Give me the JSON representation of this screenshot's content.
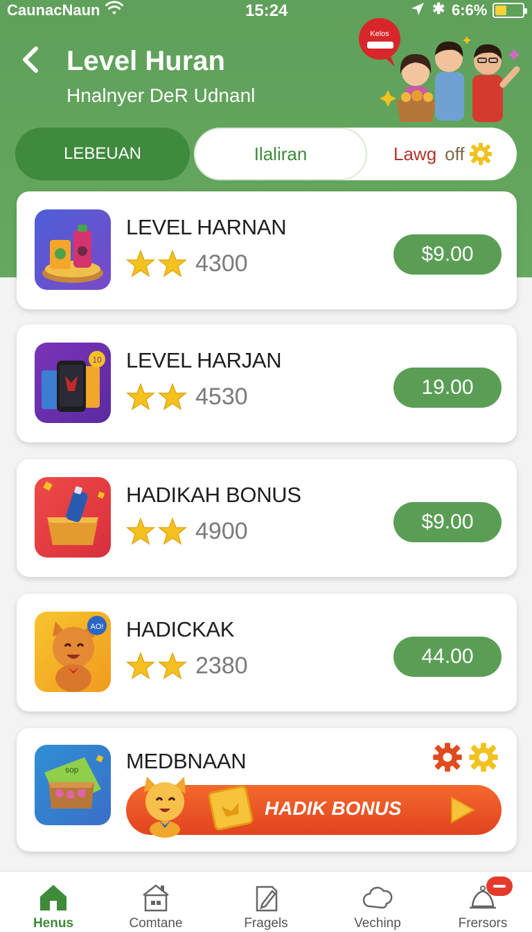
{
  "status_bar": {
    "carrier": "CaunacNaun",
    "time": "15:24",
    "battery": "6:6%",
    "bluetooth_glyph": "✱"
  },
  "header": {
    "back_icon": "chevron-left-icon",
    "title": "Level Huran",
    "subtitle": "Hnalnyer DeR Udnanl",
    "bubble_text": "Kelos"
  },
  "tabs": [
    {
      "label": "LEBEUAN",
      "active": true
    },
    {
      "label": "Ilaliran",
      "active": false
    },
    {
      "label": "Lawg",
      "label_suffix": "off",
      "active": false,
      "icon": "gear-icon"
    }
  ],
  "items": [
    {
      "name": "LEVEL HARNAN",
      "score": "4300",
      "price": "$9.00",
      "stars": 2
    },
    {
      "name": "LEVEL HARJAN",
      "score": "4530",
      "price": "19.00",
      "stars": 2
    },
    {
      "name": "HADIKAH BONUS",
      "score": "4900",
      "price": "$9.00",
      "stars": 2
    },
    {
      "name": "HADICKAK",
      "score": "2380",
      "price": "44.00",
      "stars": 2
    }
  ],
  "promo": {
    "name": "MEDBNAAN",
    "banner_label": "HADIK BONUS",
    "icon_tag": "sop"
  },
  "thumb_tags": {
    "item_2": "10",
    "item_4": "AO!"
  },
  "bottom_nav": [
    {
      "label": "Henus",
      "icon": "home-icon",
      "active": true
    },
    {
      "label": "Comtane",
      "icon": "store-icon",
      "active": false
    },
    {
      "label": "Fragels",
      "icon": "edit-doc-icon",
      "active": false
    },
    {
      "label": "Vechinp",
      "icon": "cloud-icon",
      "active": false
    },
    {
      "label": "Frersors",
      "icon": "bell-icon",
      "active": false
    }
  ],
  "colors": {
    "brand_green": "#5fa05a",
    "button_green": "#5a9e55",
    "active_tab": "#3f8a3d",
    "promo_orange": "#e2431f",
    "star_gold": "#f4c21f"
  }
}
